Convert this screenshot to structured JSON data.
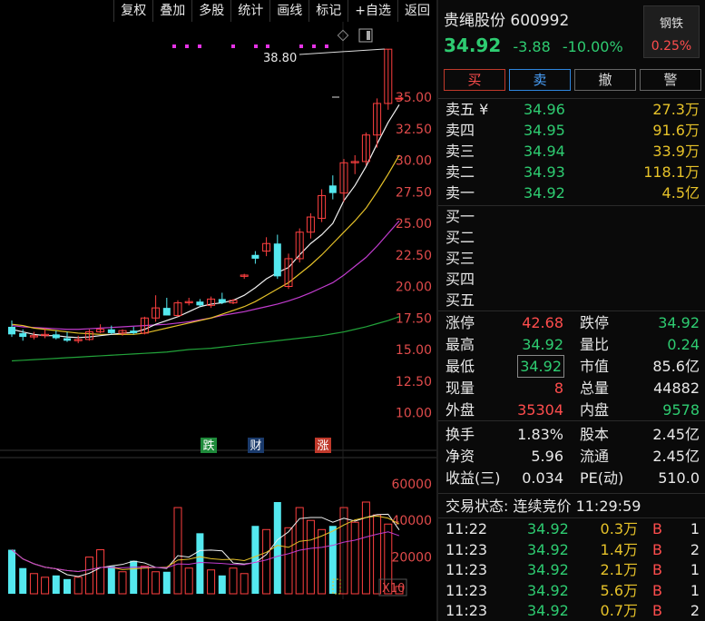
{
  "toolbar": [
    "复权",
    "叠加",
    "多股",
    "统计",
    "画线",
    "标记",
    "+自选",
    "返回"
  ],
  "stock": {
    "name": "贵绳股份",
    "code": "600992",
    "price": "34.92",
    "change": "-3.88",
    "pct": "-10.00%"
  },
  "sector": {
    "name": "钢铁",
    "pct": "0.25%"
  },
  "trade_buttons": [
    "买",
    "卖",
    "撤",
    "警"
  ],
  "chart_data": {
    "type": "candlestick",
    "annotation_high": "38.80",
    "y_ticks": [
      "35.00",
      "32.50",
      "30.00",
      "27.50",
      "25.00",
      "22.50",
      "20.00",
      "17.50",
      "15.00",
      "12.50",
      "10.00"
    ],
    "vol_ticks": [
      "60000",
      "40000",
      "20000"
    ],
    "vol_unit": "X10",
    "markers": [
      {
        "label": "跌",
        "color": "#1e8a3a"
      },
      {
        "label": "财",
        "color": "#1a3a6b"
      },
      {
        "label": "涨",
        "color": "#c0392b"
      }
    ],
    "candles": [
      [
        16.8,
        17.3,
        16.0,
        16.2
      ],
      [
        16.3,
        16.6,
        15.7,
        16.0
      ],
      [
        16.0,
        16.4,
        15.8,
        16.1
      ],
      [
        16.1,
        16.7,
        15.9,
        16.2
      ],
      [
        16.2,
        16.5,
        15.8,
        15.9
      ],
      [
        15.9,
        16.4,
        15.6,
        15.7
      ],
      [
        15.7,
        16.1,
        15.5,
        15.8
      ],
      [
        15.8,
        16.6,
        15.7,
        16.4
      ],
      [
        16.4,
        17.0,
        16.3,
        16.6
      ],
      [
        16.6,
        16.9,
        16.2,
        16.3
      ],
      [
        16.3,
        16.6,
        16.1,
        16.5
      ],
      [
        16.5,
        16.8,
        16.2,
        16.3
      ],
      [
        16.3,
        17.6,
        16.2,
        17.5
      ],
      [
        17.5,
        19.3,
        17.2,
        18.3
      ],
      [
        18.3,
        19.1,
        17.7,
        17.7
      ],
      [
        17.7,
        18.9,
        17.6,
        18.7
      ],
      [
        18.7,
        19.1,
        18.5,
        18.8
      ],
      [
        18.8,
        19.0,
        18.4,
        18.5
      ],
      [
        18.5,
        19.2,
        18.3,
        19.0
      ],
      [
        19.0,
        19.5,
        18.6,
        18.7
      ],
      [
        18.7,
        19.0,
        18.6,
        18.9
      ],
      [
        20.8,
        21.0,
        20.6,
        20.9
      ],
      [
        22.5,
        22.8,
        21.8,
        22.2
      ],
      [
        22.8,
        23.9,
        22.4,
        23.4
      ],
      [
        23.4,
        24.1,
        20.6,
        20.8
      ],
      [
        20.0,
        22.6,
        19.8,
        22.2
      ],
      [
        22.2,
        24.6,
        21.9,
        24.3
      ],
      [
        24.3,
        25.8,
        23.8,
        25.5
      ],
      [
        25.4,
        27.7,
        25.1,
        27.2
      ],
      [
        28.0,
        28.8,
        26.9,
        27.4
      ],
      [
        27.4,
        30.1,
        26.7,
        29.8
      ],
      [
        29.8,
        30.4,
        28.9,
        29.9
      ],
      [
        29.9,
        32.2,
        29.6,
        32.0
      ],
      [
        32.0,
        34.9,
        31.0,
        34.5
      ],
      [
        34.5,
        38.8,
        34.0,
        38.8
      ],
      [
        34.92,
        34.92,
        34.92,
        34.92
      ]
    ],
    "volumes": [
      24000,
      14000,
      11000,
      9000,
      10000,
      8000,
      9000,
      20000,
      24000,
      15000,
      12000,
      18000,
      15000,
      12000,
      12000,
      47000,
      14000,
      33000,
      13000,
      10000,
      14000,
      11000,
      37000,
      35000,
      50000,
      36000,
      47000,
      40000,
      35000,
      37000,
      47000,
      39000,
      50000,
      43000,
      38000,
      4000
    ],
    "ma5": [
      16.6,
      16.4,
      16.2,
      16.1,
      16.1,
      16.0,
      15.95,
      16.0,
      16.1,
      16.2,
      16.3,
      16.35,
      16.6,
      17.0,
      17.3,
      17.6,
      18.0,
      18.4,
      18.6,
      18.7,
      18.9,
      19.3,
      19.9,
      20.6,
      21.1,
      21.5,
      22.5,
      23.4,
      24.1,
      25.0,
      26.8,
      28.0,
      29.5,
      31.3,
      33.0,
      34.4
    ],
    "ma10": [
      17.0,
      16.9,
      16.7,
      16.6,
      16.5,
      16.4,
      16.3,
      16.25,
      16.2,
      16.2,
      16.2,
      16.2,
      16.3,
      16.5,
      16.7,
      16.9,
      17.1,
      17.3,
      17.5,
      17.8,
      18.1,
      18.4,
      18.8,
      19.3,
      19.8,
      20.3,
      21.0,
      21.7,
      22.5,
      23.4,
      24.3,
      25.2,
      26.2,
      27.5,
      28.9,
      30.4
    ],
    "ma20": [
      16.9,
      16.8,
      16.75,
      16.7,
      16.65,
      16.6,
      16.6,
      16.65,
      16.7,
      16.75,
      16.8,
      16.85,
      16.9,
      16.95,
      17.0,
      17.1,
      17.2,
      17.35,
      17.5,
      17.7,
      17.85,
      18.0,
      18.2,
      18.4,
      18.6,
      18.85,
      19.15,
      19.5,
      19.9,
      20.3,
      20.9,
      21.6,
      22.3,
      23.2,
      24.2,
      25.2
    ],
    "ma60": [
      14.1,
      14.15,
      14.2,
      14.25,
      14.3,
      14.35,
      14.4,
      14.45,
      14.5,
      14.55,
      14.6,
      14.65,
      14.7,
      14.75,
      14.8,
      14.9,
      15.0,
      15.05,
      15.1,
      15.2,
      15.3,
      15.4,
      15.5,
      15.6,
      15.7,
      15.8,
      15.9,
      16.0,
      16.1,
      16.25,
      16.4,
      16.6,
      16.8,
      17.05,
      17.3,
      17.6
    ]
  },
  "asks": [
    {
      "label": "卖五 ¥",
      "price": "34.96",
      "vol": "27.3万"
    },
    {
      "label": "卖四",
      "price": "34.95",
      "vol": "91.6万"
    },
    {
      "label": "卖三",
      "price": "34.94",
      "vol": "33.9万"
    },
    {
      "label": "卖二",
      "price": "34.93",
      "vol": "118.1万"
    },
    {
      "label": "卖一",
      "price": "34.92",
      "vol": "4.5亿"
    }
  ],
  "bids": [
    "买一",
    "买二",
    "买三",
    "买四",
    "买五"
  ],
  "stats": [
    {
      "l1": "涨停",
      "v1": "42.68",
      "c1": "r",
      "l2": "跌停",
      "v2": "34.92",
      "c2": "g"
    },
    {
      "l1": "最高",
      "v1": "34.92",
      "c1": "g",
      "l2": "量比",
      "v2": "0.24",
      "c2": "g"
    },
    {
      "l1": "最低",
      "v1": "34.92",
      "c1": "g",
      "l2": "市值",
      "v2": "85.6亿",
      "c2": "w"
    },
    {
      "l1": "现量",
      "v1": "8",
      "c1": "r",
      "l2": "总量",
      "v2": "44882",
      "c2": "w"
    },
    {
      "l1": "外盘",
      "v1": "35304",
      "c1": "r",
      "l2": "内盘",
      "v2": "9578",
      "c2": "g"
    }
  ],
  "fin": [
    {
      "l1": "换手",
      "v1": "1.83%",
      "l2": "股本",
      "v2": "2.45亿"
    },
    {
      "l1": "净资",
      "v1": "5.96",
      "l2": "流通",
      "v2": "2.45亿"
    },
    {
      "l1": "收益(三)",
      "v1": "0.034",
      "l2": "PE(动)",
      "v2": "510.0"
    }
  ],
  "status": "交易状态: 连续竞价 11:29:59",
  "trades": [
    {
      "t": "11:22",
      "p": "34.92",
      "v": "0.3万",
      "s": "B",
      "n": "1"
    },
    {
      "t": "11:23",
      "p": "34.92",
      "v": "1.4万",
      "s": "B",
      "n": "2"
    },
    {
      "t": "11:23",
      "p": "34.92",
      "v": "2.1万",
      "s": "B",
      "n": "1"
    },
    {
      "t": "11:23",
      "p": "34.92",
      "v": "5.6万",
      "s": "B",
      "n": "1"
    },
    {
      "t": "11:23",
      "p": "34.92",
      "v": "0.7万",
      "s": "B",
      "n": "2"
    }
  ]
}
